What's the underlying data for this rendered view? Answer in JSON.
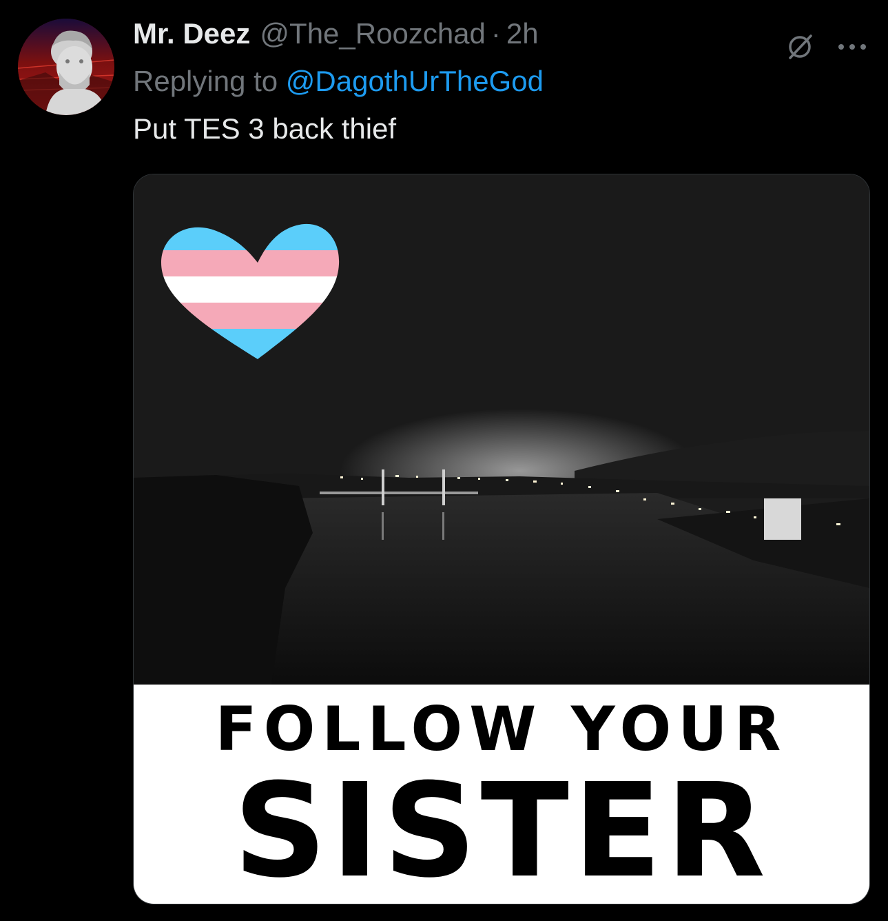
{
  "tweet": {
    "author": {
      "display_name": "Mr. Deez",
      "handle": "@The_Roozchad",
      "avatar_icon": "statue-bust-avatar"
    },
    "separator": "·",
    "time": "2h",
    "replying_prefix": "Replying to",
    "replying_handle": "@DagothUrTheGod",
    "text": "Put TES 3 back thief",
    "header_icons": [
      "grok-slash-icon",
      "more-options-icon"
    ],
    "media": {
      "overlay_icon": "trans-flag-heart",
      "caption_line1": "FOLLOW YOUR",
      "caption_line2": "SISTER"
    }
  },
  "colors": {
    "background": "#000000",
    "primary_text": "#e7e9ea",
    "secondary_text": "#71767b",
    "link": "#1d9bf0",
    "flag_blue": "#5bcefa",
    "flag_pink": "#f5a9b8",
    "flag_white": "#ffffff"
  }
}
